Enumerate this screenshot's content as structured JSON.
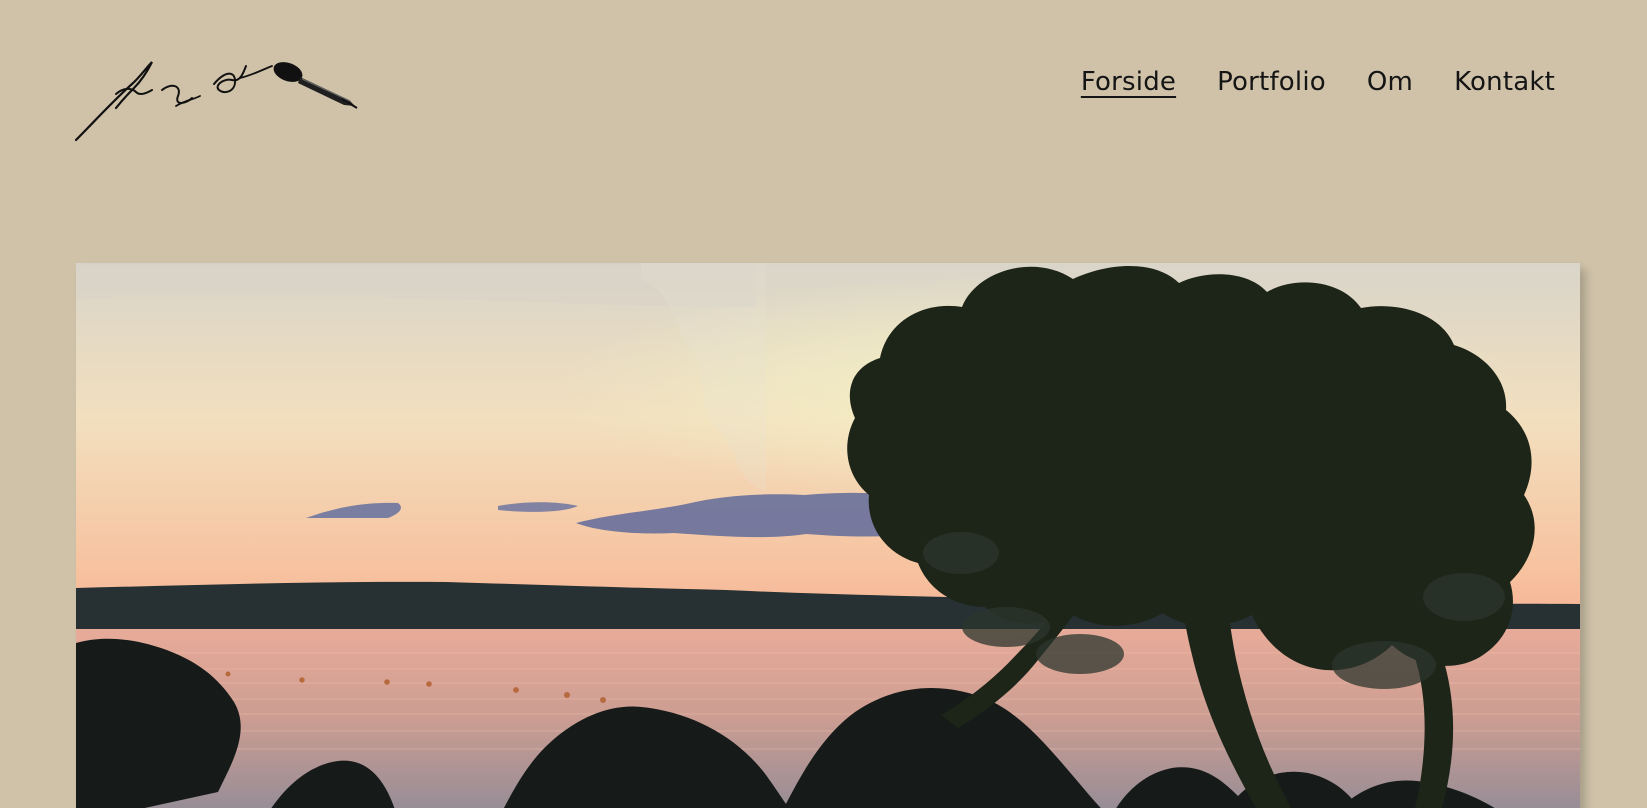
{
  "header": {
    "logo": {
      "alt": "Jan Lauesen signature logo with paint brush"
    },
    "nav": [
      {
        "label": "Forside",
        "active": true
      },
      {
        "label": "Portfolio",
        "active": false
      },
      {
        "label": "Om",
        "active": false
      },
      {
        "label": "Kontakt",
        "active": false
      }
    ]
  },
  "hero": {
    "image": "sunset-lake-photo"
  },
  "colors": {
    "page_background": "#cfc2a8",
    "nav_text": "#151515"
  }
}
